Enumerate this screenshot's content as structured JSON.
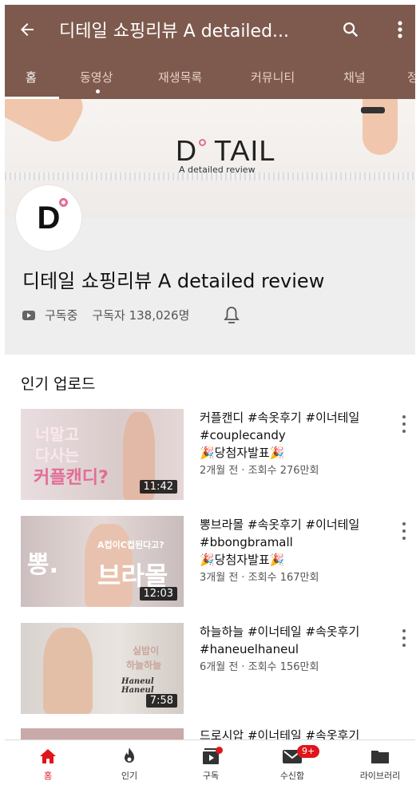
{
  "app_bar": {
    "title": "디테일 쇼핑리뷰 A detailed..."
  },
  "tabs": [
    {
      "label": "홈",
      "active": true
    },
    {
      "label": "동영상",
      "active": false
    },
    {
      "label": "재생목록",
      "active": false
    },
    {
      "label": "커뮤니티",
      "active": false
    },
    {
      "label": "채널",
      "active": false
    },
    {
      "label": "정",
      "active": false
    }
  ],
  "banner": {
    "logo_text": "D TAIL",
    "tagline": "A detailed review"
  },
  "channel": {
    "avatar_letter": "D",
    "name": "디테일 쇼핑리뷰 A detailed review",
    "subscribed_label": "구독중",
    "subscriber_count": "구독자 138,026명"
  },
  "section": {
    "title": "인기 업로드"
  },
  "videos": [
    {
      "title_line1": "커플캔디 #속옷후기 #이너테일",
      "title_line2": "#couplecandy",
      "title_line3": "🎉당첨자발표🎉",
      "meta": "2개월 전 · 조회수 276만회",
      "duration": "11:42",
      "thumb_text1": "너말고",
      "thumb_text2": "다사는",
      "thumb_text3": "커플캔디?"
    },
    {
      "title_line1": "뽕브라몰 #속옷후기 #이너테일",
      "title_line2": "#bbongbramall",
      "title_line3": "🎉당첨자발표🎉",
      "meta": "3개월 전 · 조회수 167만회",
      "duration": "12:03",
      "thumb_text1": "뽕.",
      "thumb_text2": "브라몰",
      "thumb_text3": "A컵이C컵된다고?"
    },
    {
      "title_line1": "하늘하늘 #이너테일 #속옷후기",
      "title_line2": "#haneuelhaneul",
      "title_line3": "",
      "meta": "6개월 전 · 조회수 156만회",
      "duration": "7:58",
      "thumb_text1": "실밥이",
      "thumb_text2": "하늘하늘",
      "thumb_text3": "Haneul Haneul"
    },
    {
      "title_line1": "드로시압 #이너테일 #속옷후기"
    }
  ],
  "bottom_nav": [
    {
      "label": "홈",
      "icon": "home-icon",
      "active": true
    },
    {
      "label": "인기",
      "icon": "flame-icon",
      "active": false
    },
    {
      "label": "구독",
      "icon": "subscriptions-icon",
      "active": false
    },
    {
      "label": "수신함",
      "icon": "inbox-icon",
      "active": false,
      "badge": "9+"
    },
    {
      "label": "라이브러리",
      "icon": "library-icon",
      "active": false
    }
  ],
  "colors": {
    "header_bg": "#7e5a4e",
    "accent_red": "#e0151b",
    "pink": "#e36c98"
  }
}
